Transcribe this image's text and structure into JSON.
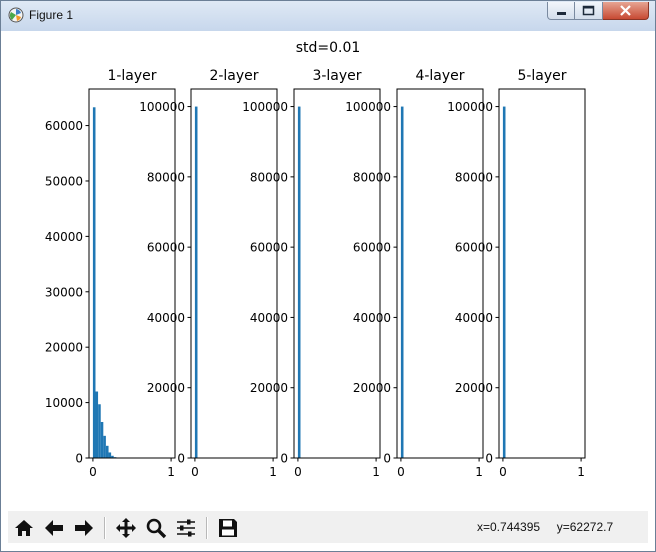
{
  "window": {
    "title": "Figure 1",
    "icon": "matplotlib-figure-icon",
    "controls": [
      "minimize-icon",
      "maximize-icon",
      "close-icon"
    ]
  },
  "figure": {
    "suptitle": "std=0.01"
  },
  "chart_data": [
    {
      "type": "bar",
      "title": "1-layer",
      "xlabel": "",
      "ylabel": "",
      "xlim": [
        -0.05,
        1.05
      ],
      "ylim": [
        0,
        66600
      ],
      "xticks": [
        0,
        1
      ],
      "yticks": [
        0,
        10000,
        20000,
        30000,
        40000,
        50000,
        60000
      ],
      "bin_width": 0.033,
      "bins": [
        0.0,
        0.033,
        0.067,
        0.1,
        0.133,
        0.167,
        0.2,
        0.233,
        0.267
      ],
      "values": [
        63300,
        12000,
        9700,
        6500,
        4000,
        2200,
        1000,
        400,
        150
      ],
      "color": "#1f77b4"
    },
    {
      "type": "bar",
      "title": "2-layer",
      "xlabel": "",
      "ylabel": "",
      "xlim": [
        -0.05,
        1.05
      ],
      "ylim": [
        0,
        105000
      ],
      "xticks": [
        0,
        1
      ],
      "yticks": [
        0,
        20000,
        40000,
        60000,
        80000,
        100000
      ],
      "bin_width": 0.033,
      "bins": [
        0.0
      ],
      "values": [
        100000
      ],
      "color": "#1f77b4"
    },
    {
      "type": "bar",
      "title": "3-layer",
      "xlabel": "",
      "ylabel": "",
      "xlim": [
        -0.05,
        1.05
      ],
      "ylim": [
        0,
        105000
      ],
      "xticks": [
        0,
        1
      ],
      "yticks": [
        0,
        20000,
        40000,
        60000,
        80000,
        100000
      ],
      "bin_width": 0.033,
      "bins": [
        0.0
      ],
      "values": [
        100000
      ],
      "color": "#1f77b4"
    },
    {
      "type": "bar",
      "title": "4-layer",
      "xlabel": "",
      "ylabel": "",
      "xlim": [
        -0.05,
        1.05
      ],
      "ylim": [
        0,
        105000
      ],
      "xticks": [
        0,
        1
      ],
      "yticks": [
        0,
        20000,
        40000,
        60000,
        80000,
        100000
      ],
      "bin_width": 0.033,
      "bins": [
        0.0
      ],
      "values": [
        100000
      ],
      "color": "#1f77b4"
    },
    {
      "type": "bar",
      "title": "5-layer",
      "xlabel": "",
      "ylabel": "",
      "xlim": [
        -0.05,
        1.05
      ],
      "ylim": [
        0,
        105000
      ],
      "xticks": [
        0,
        1
      ],
      "yticks": [
        0,
        20000,
        40000,
        60000,
        80000,
        100000
      ],
      "bin_width": 0.033,
      "bins": [
        0.0
      ],
      "values": [
        100000
      ],
      "color": "#1f77b4"
    }
  ],
  "toolbar": {
    "buttons": [
      "home-icon",
      "back-arrow-icon",
      "forward-arrow-icon",
      "pan-icon",
      "zoom-icon",
      "configure-subplots-icon",
      "save-icon"
    ]
  },
  "status": {
    "x": "x=0.744395",
    "y": "y=62272.7"
  },
  "colors": {
    "bar": "#1f77b4",
    "axes": "#000000",
    "background": "#ffffff",
    "toolbar": "#f0f0f0"
  }
}
